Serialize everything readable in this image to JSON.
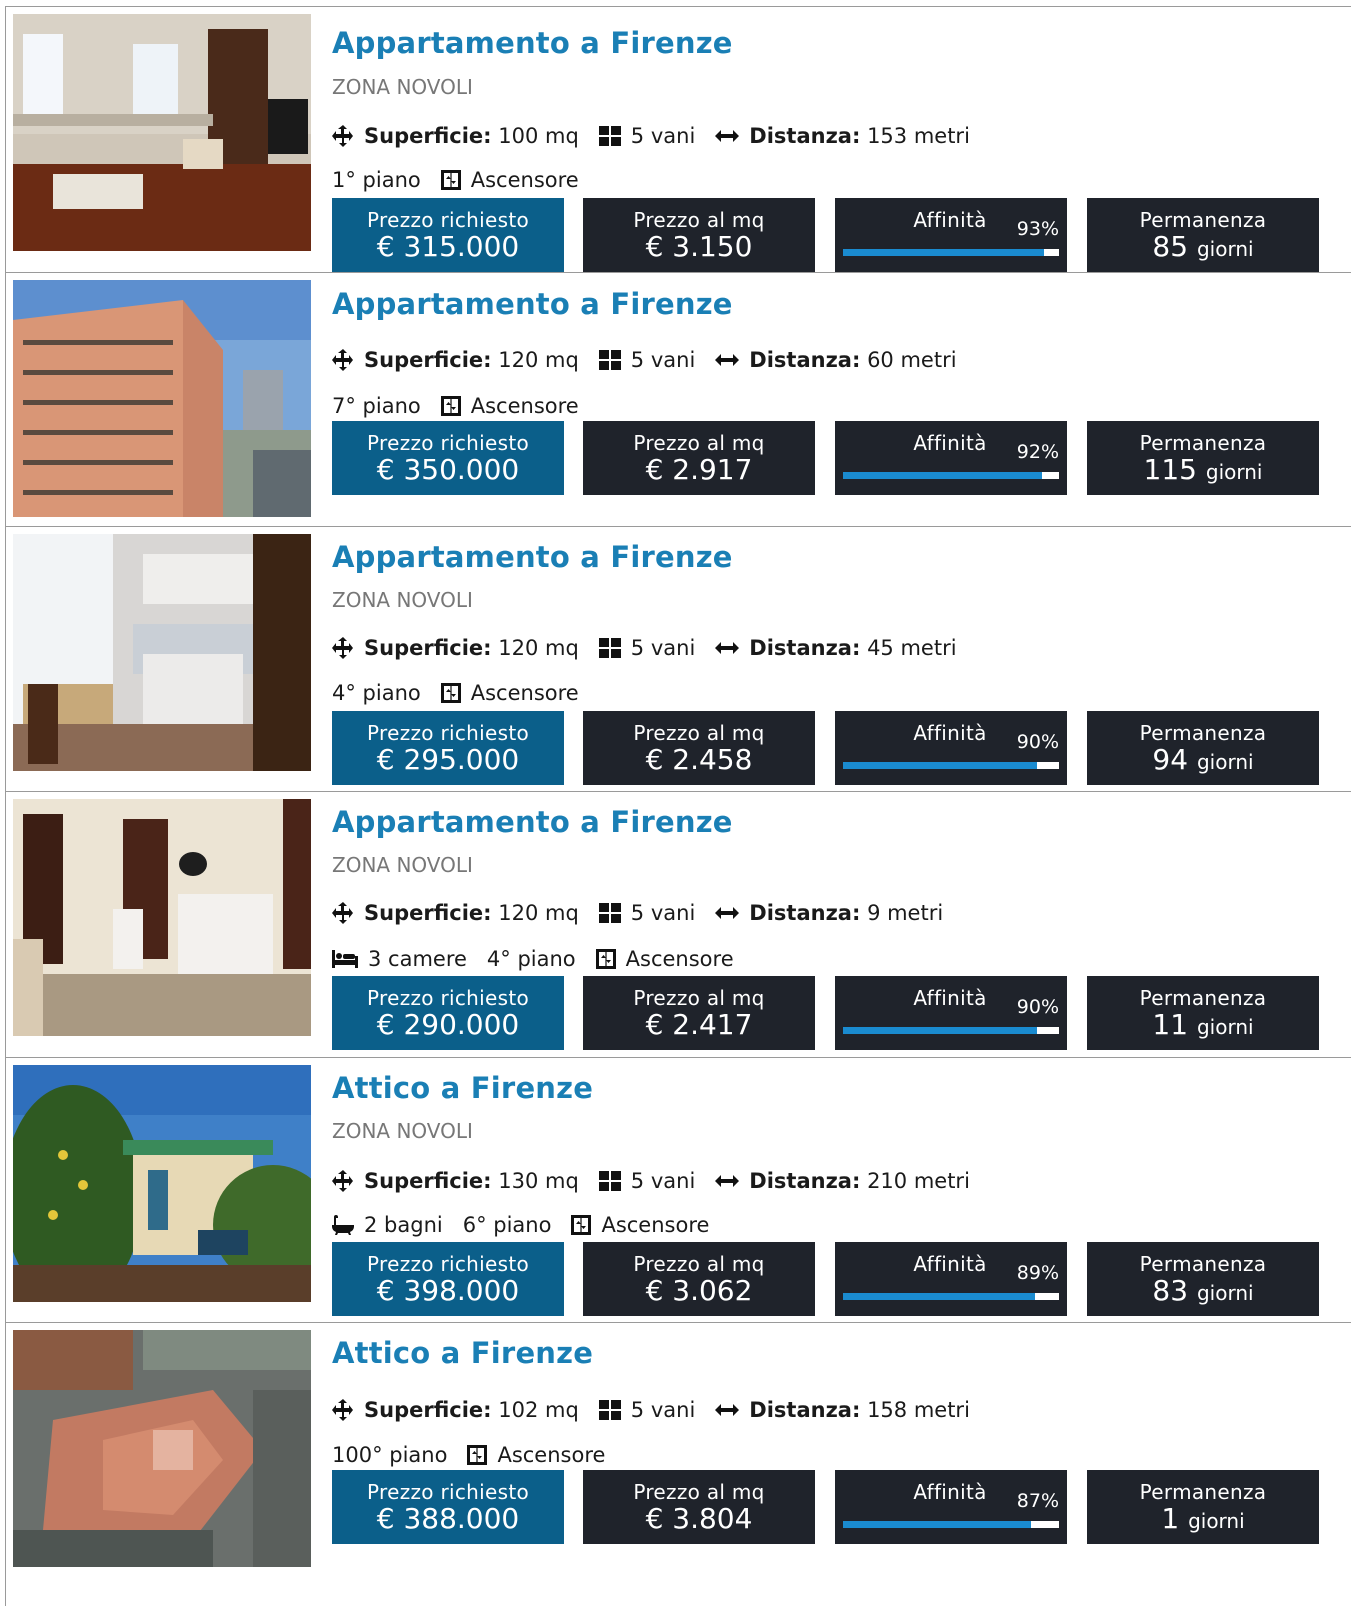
{
  "colors": {
    "title": "#1a7fb5",
    "price_box": "#0b5f8a",
    "dark_box": "#1f232b",
    "bar": "#1a8bd0"
  },
  "labels": {
    "superficie": "Superficie:",
    "distanza": "Distanza:",
    "prezzo_richiesto": "Prezzo richiesto",
    "prezzo_mq": "Prezzo al mq",
    "affinita": "Affinità",
    "permanenza": "Permanenza",
    "ascensore": "Ascensore",
    "giorni": "giorni"
  },
  "listings": [
    {
      "title": "Appartamento a Firenze",
      "zona": "ZONA NOVOLI",
      "superficie": "100 mq",
      "vani": "5 vani",
      "distanza": "153 metri",
      "camere": "",
      "bagni": "",
      "piano": "1° piano",
      "prezzo": "€ 315.000",
      "prezzo_mq": "€ 3.150",
      "affinita": 93,
      "affinita_label": "93%",
      "permanenza": "85"
    },
    {
      "title": "Appartamento a Firenze",
      "zona": "",
      "superficie": "120 mq",
      "vani": "5 vani",
      "distanza": "60 metri",
      "camere": "",
      "bagni": "",
      "piano": "7° piano",
      "prezzo": "€ 350.000",
      "prezzo_mq": "€ 2.917",
      "affinita": 92,
      "affinita_label": "92%",
      "permanenza": "115"
    },
    {
      "title": "Appartamento a Firenze",
      "zona": "ZONA NOVOLI",
      "superficie": "120 mq",
      "vani": "5 vani",
      "distanza": "45 metri",
      "camere": "",
      "bagni": "",
      "piano": "4° piano",
      "prezzo": "€ 295.000",
      "prezzo_mq": "€ 2.458",
      "affinita": 90,
      "affinita_label": "90%",
      "permanenza": "94"
    },
    {
      "title": "Appartamento a Firenze",
      "zona": "ZONA NOVOLI",
      "superficie": "120 mq",
      "vani": "5 vani",
      "distanza": "9 metri",
      "camere": "3 camere",
      "bagni": "",
      "piano": "4° piano",
      "prezzo": "€ 290.000",
      "prezzo_mq": "€ 2.417",
      "affinita": 90,
      "affinita_label": "90%",
      "permanenza": "11"
    },
    {
      "title": "Attico a Firenze",
      "zona": "ZONA NOVOLI",
      "superficie": "130 mq",
      "vani": "5 vani",
      "distanza": "210 metri",
      "camere": "",
      "bagni": "2 bagni",
      "piano": "6° piano",
      "prezzo": "€ 398.000",
      "prezzo_mq": "€ 3.062",
      "affinita": 89,
      "affinita_label": "89%",
      "permanenza": "83"
    },
    {
      "title": "Attico a Firenze",
      "zona": "",
      "superficie": "102 mq",
      "vani": "5 vani",
      "distanza": "158 metri",
      "camere": "",
      "bagni": "",
      "piano": "100° piano",
      "prezzo": "€ 388.000",
      "prezzo_mq": "€ 3.804",
      "affinita": 87,
      "affinita_label": "87%",
      "permanenza": "1"
    }
  ]
}
